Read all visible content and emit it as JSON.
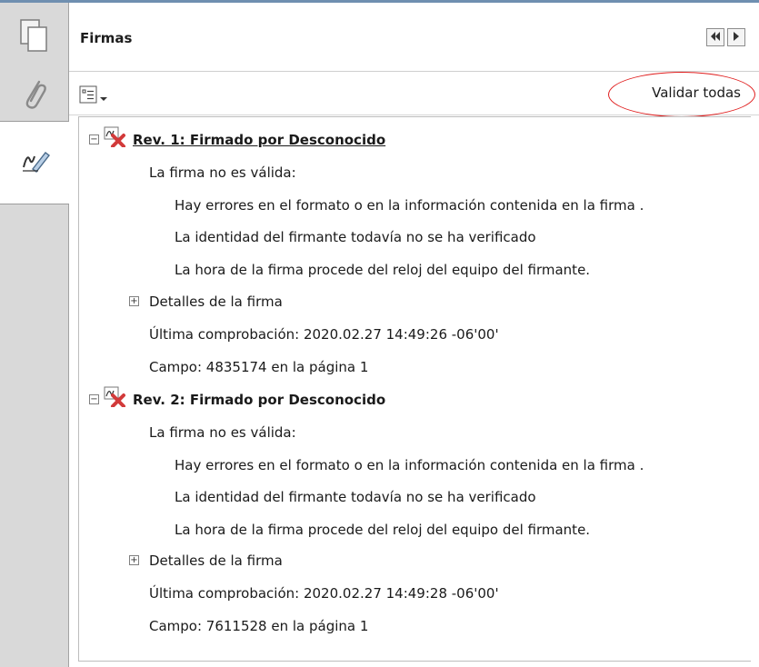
{
  "panel": {
    "title": "Firmas",
    "validate_all": "Validar todas"
  },
  "icons": {
    "pages": "pages-icon",
    "attachments": "paperclip-icon",
    "signatures": "signature-pen-icon",
    "options": "options-list-icon",
    "collapse": "double-left-arrow-icon",
    "next": "right-arrow-icon",
    "invalid_signature": "invalid-signature-icon"
  },
  "colors": {
    "annotation_circle": "#e01e1e",
    "nav_background": "#d9d9d9"
  },
  "signatures": [
    {
      "heading": "Rev. 1: Firmado por Desconocido",
      "status": "La firma no es válida:",
      "details": [
        "Hay errores en el formato o en la información contenida en la firma .",
        "La identidad del firmante todavía no se ha verificado",
        "La hora de la firma procede del reloj del equipo del firmante."
      ],
      "details_toggle": "Detalles de la firma",
      "last_check": "Última comprobación: 2020.02.27 14:49:26 -06'00'",
      "field": "Campo: 4835174 en la página 1"
    },
    {
      "heading": "Rev. 2: Firmado por Desconocido",
      "status": "La firma no es válida:",
      "details": [
        "Hay errores en el formato o en la información contenida en la firma .",
        "La identidad del firmante todavía no se ha verificado",
        "La hora de la firma procede del reloj del equipo del firmante."
      ],
      "details_toggle": "Detalles de la firma",
      "last_check": "Última comprobación: 2020.02.27 14:49:28 -06'00'",
      "field": "Campo: 7611528 en la página 1"
    }
  ]
}
